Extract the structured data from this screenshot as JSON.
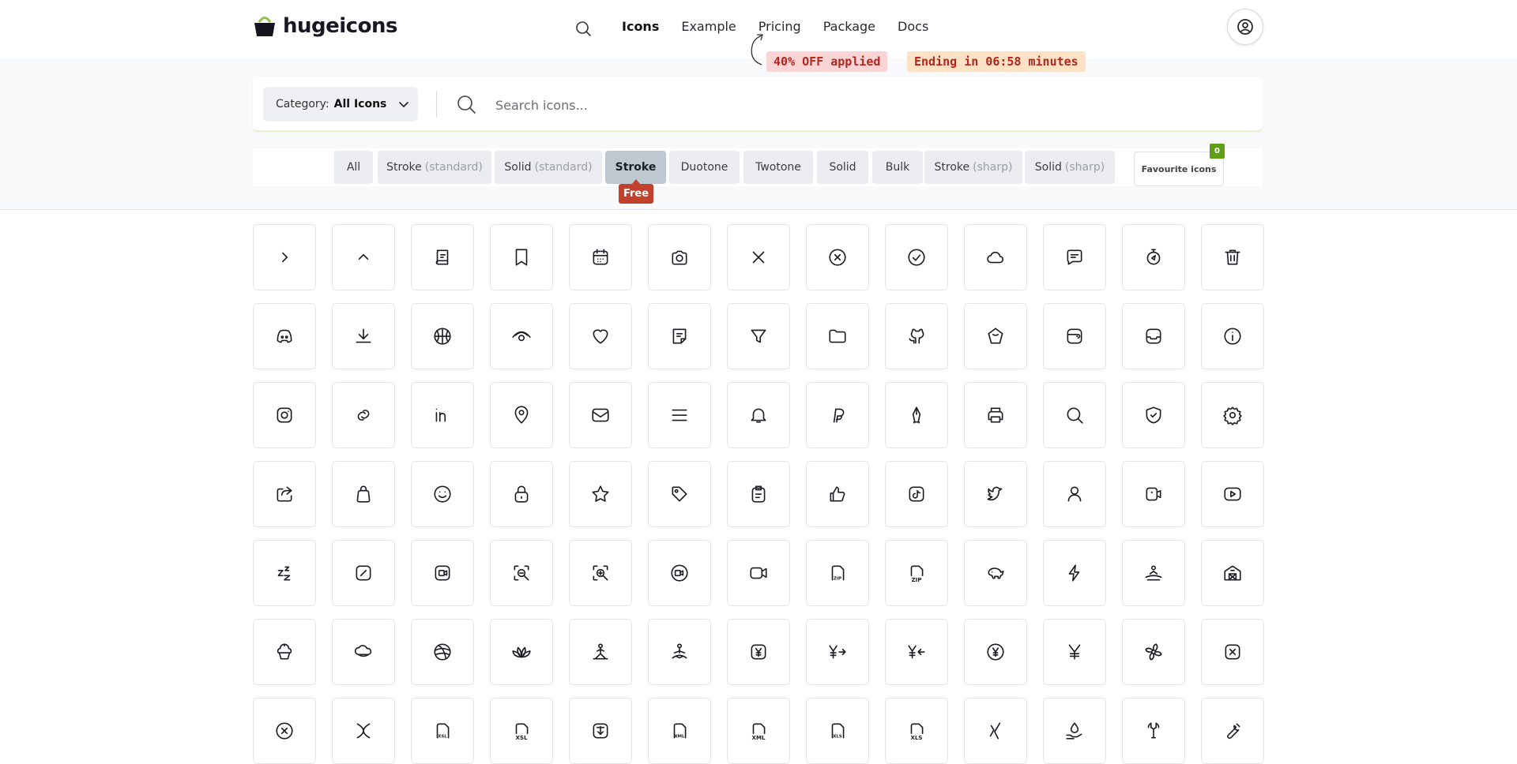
{
  "nav": {
    "brand": "hugeicons",
    "links": [
      {
        "label": "Icons",
        "active": true
      },
      {
        "label": "Example",
        "active": false
      },
      {
        "label": "Pricing",
        "active": false
      },
      {
        "label": "Package",
        "active": false
      },
      {
        "label": "Docs",
        "active": false
      }
    ],
    "search_icon": "search-icon",
    "account_icon": "user-circle-icon"
  },
  "promo": {
    "discount": "40% OFF applied",
    "countdown": "Ending in 06:58 minutes"
  },
  "search": {
    "category_label": "Category:",
    "category_value": "All Icons",
    "placeholder": "Search icons..."
  },
  "filters": [
    {
      "label": "All",
      "sub": ""
    },
    {
      "label": "Stroke",
      "sub": "(standard)"
    },
    {
      "label": "Solid",
      "sub": "(standard)"
    },
    {
      "label": "Stroke",
      "sub": "",
      "active": true
    },
    {
      "label": "Duotone",
      "sub": ""
    },
    {
      "label": "Twotone",
      "sub": ""
    },
    {
      "label": "Solid",
      "sub": ""
    },
    {
      "label": "Bulk",
      "sub": ""
    },
    {
      "label": "Stroke",
      "sub": "(sharp)"
    },
    {
      "label": "Solid",
      "sub": "(sharp)"
    }
  ],
  "favourites": {
    "label": "Favourite icons",
    "count": "0"
  },
  "free_badge": "Free",
  "icons": [
    [
      "chevron-right",
      "chevron-up",
      "book",
      "bookmark",
      "calendar",
      "camera",
      "x",
      "circle-x",
      "circle-check",
      "cloud",
      "message-text",
      "stopwatch",
      "trash"
    ],
    [
      "discord",
      "download",
      "basketball",
      "eye",
      "heart",
      "note",
      "filter",
      "folder",
      "github",
      "hexagon",
      "wallet",
      "inbox",
      "info"
    ],
    [
      "instagram",
      "link",
      "linkedin",
      "location",
      "mail",
      "menu",
      "bell",
      "paypal",
      "pen",
      "printer",
      "search",
      "shield-check",
      "settings"
    ],
    [
      "share",
      "bag",
      "smile",
      "lock",
      "star",
      "tag",
      "clipboard",
      "thumbs-up",
      "tiktok",
      "twitter",
      "user",
      "video-square",
      "youtube"
    ],
    [
      "zzz",
      "square-slash",
      "video-box",
      "zoom-out",
      "zoom-in",
      "video-circle",
      "video",
      "zip-file",
      "zip",
      "piggy-bank",
      "zap",
      "yoga-mat",
      "barn"
    ],
    [
      "cupcake",
      "cloud-rain",
      "ball",
      "lotus",
      "yoga",
      "meditation",
      "yen-square",
      "yen-send",
      "yen-receive",
      "yen-circle",
      "yen",
      "fan",
      "square-x"
    ],
    [
      "circle-x-2",
      "x-curve",
      "xsl-file",
      "xsl",
      "download-square",
      "xml-file",
      "xml",
      "xls-file",
      "xls",
      "xing",
      "water-hand",
      "wrench",
      "tool"
    ]
  ],
  "colors": {
    "accent_green": "#5e9f1a",
    "free_red": "#c2412d",
    "promo_red": "#b3261e"
  }
}
